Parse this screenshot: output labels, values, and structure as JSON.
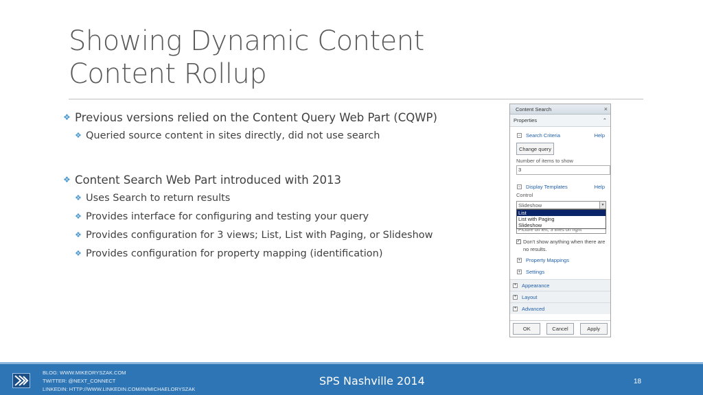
{
  "slide": {
    "title_line1": "Showing Dynamic Content",
    "title_line2": "Content Rollup",
    "bullets": [
      {
        "text": "Previous versions relied on the Content Query Web Part (CQWP)"
      },
      {
        "text": "Queried source content in sites directly, did not use search"
      },
      {
        "text": "Content Search Web Part introduced with 2013"
      },
      {
        "text": "Uses Search to return results"
      },
      {
        "text": "Provides interface for configuring and testing your query"
      },
      {
        "text": "Provides configuration for 3 views; List, List with Paging, or Slideshow"
      },
      {
        "text": "Provides configuration for property mapping (identification)"
      }
    ]
  },
  "panel": {
    "title": "Content Search",
    "close_icon": "×",
    "properties_label": "Properties",
    "collapse_icon": "⌃",
    "search_criteria": "Search Criteria",
    "help": "Help",
    "change_query": "Change query",
    "items_label": "Number of items to show",
    "items_value": "3",
    "display_templates": "Display Templates",
    "control_label": "Control",
    "control_value": "Slideshow",
    "control_options": [
      "List",
      "List with Paging",
      "Slideshow"
    ],
    "item_value": "Picture on left, 3 lines on right",
    "dont_show": "Don't show anything when there are no results.",
    "property_mappings": "Property Mappings",
    "settings": "Settings",
    "appearance": "Appearance",
    "layout": "Layout",
    "advanced": "Advanced",
    "ok": "OK",
    "cancel": "Cancel",
    "apply": "Apply"
  },
  "footer": {
    "blog": "BLOG:  WWW.MIKEORYSZAK.COM",
    "twitter": "TWITTER:  @NEXT_CONNECT",
    "linkedin": "LINKEDIN:  HTTP://WWW.LINKEDIN.COM/IN/MICHAELORYSZAK",
    "event": "SPS Nashville 2014",
    "page": "18"
  },
  "colors": {
    "accent": "#2e75b5",
    "bullet": "#4f9bd1"
  }
}
